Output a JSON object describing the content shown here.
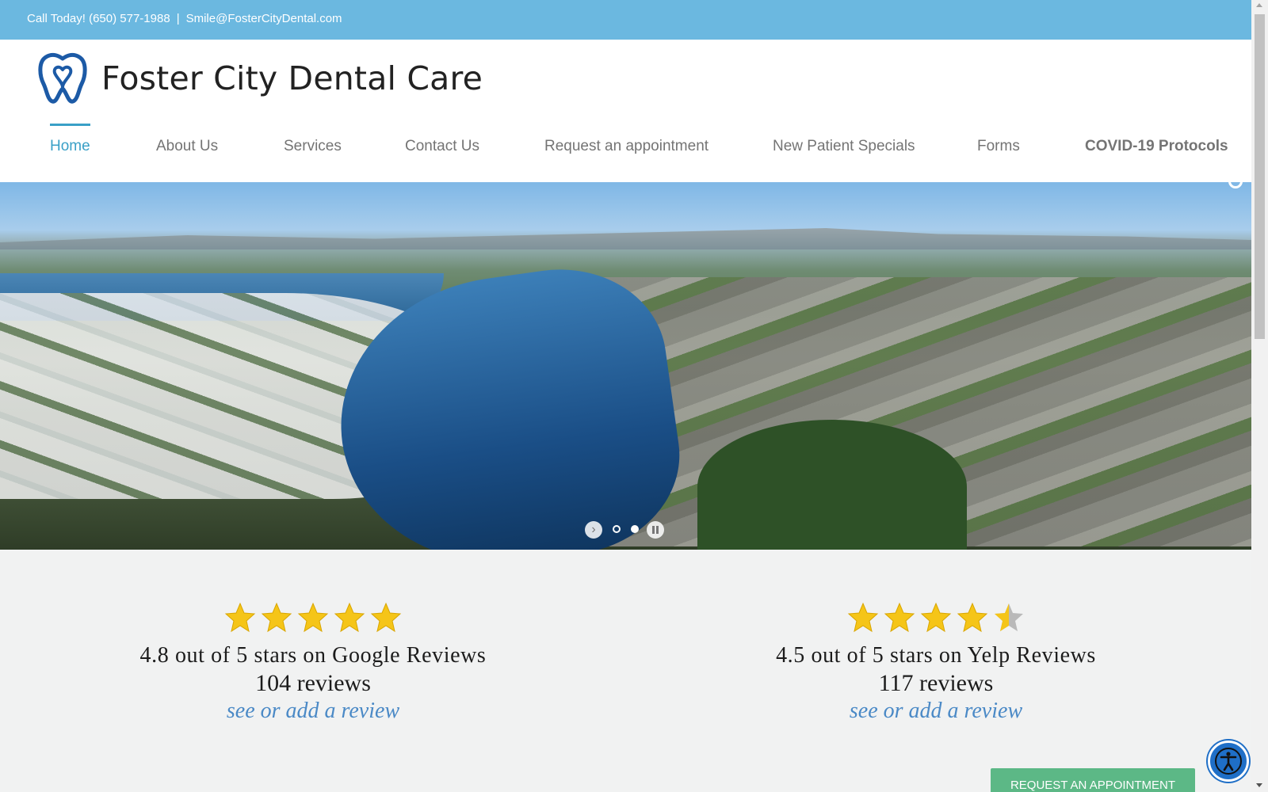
{
  "topbar": {
    "phone": "Call Today! (650) 577-1988",
    "separator": "|",
    "email": "Smile@FosterCityDental.com"
  },
  "header": {
    "logo_text": "Foster City Dental Care",
    "logo_icon": "tooth-heart-icon",
    "brand_color": "#1c5aa6"
  },
  "nav": {
    "items": [
      {
        "label": "Home",
        "active": true
      },
      {
        "label": "About Us"
      },
      {
        "label": "Services"
      },
      {
        "label": "Contact Us"
      },
      {
        "label": "Request an appointment"
      },
      {
        "label": "New Patient Specials"
      },
      {
        "label": "Forms"
      },
      {
        "label": "COVID-19 Protocols",
        "bold": true
      }
    ],
    "active_color": "#3aa0c7"
  },
  "hero": {
    "image": "aerial view of lagoon, houses and bay bridge",
    "slider_dots": 2,
    "controls": [
      "next-arrow-icon",
      "pause-icon"
    ]
  },
  "reviews": {
    "google": {
      "stars": 5,
      "rating_text": "4.8 out of 5 stars on Google Reviews",
      "count_text": "104 reviews",
      "link_text": "see or add a review"
    },
    "yelp": {
      "stars": 4.5,
      "rating_text": "4.5 out of 5 stars on Yelp Reviews",
      "count_text": "117 reviews",
      "link_text": "see or add a review"
    },
    "star_color": "#f5c518"
  },
  "cta": {
    "label": "REQUEST AN APPOINTMENT",
    "color": "#5cb886"
  },
  "accessibility": {
    "icon": "accessibility-icon",
    "color": "#1f6fc7"
  }
}
